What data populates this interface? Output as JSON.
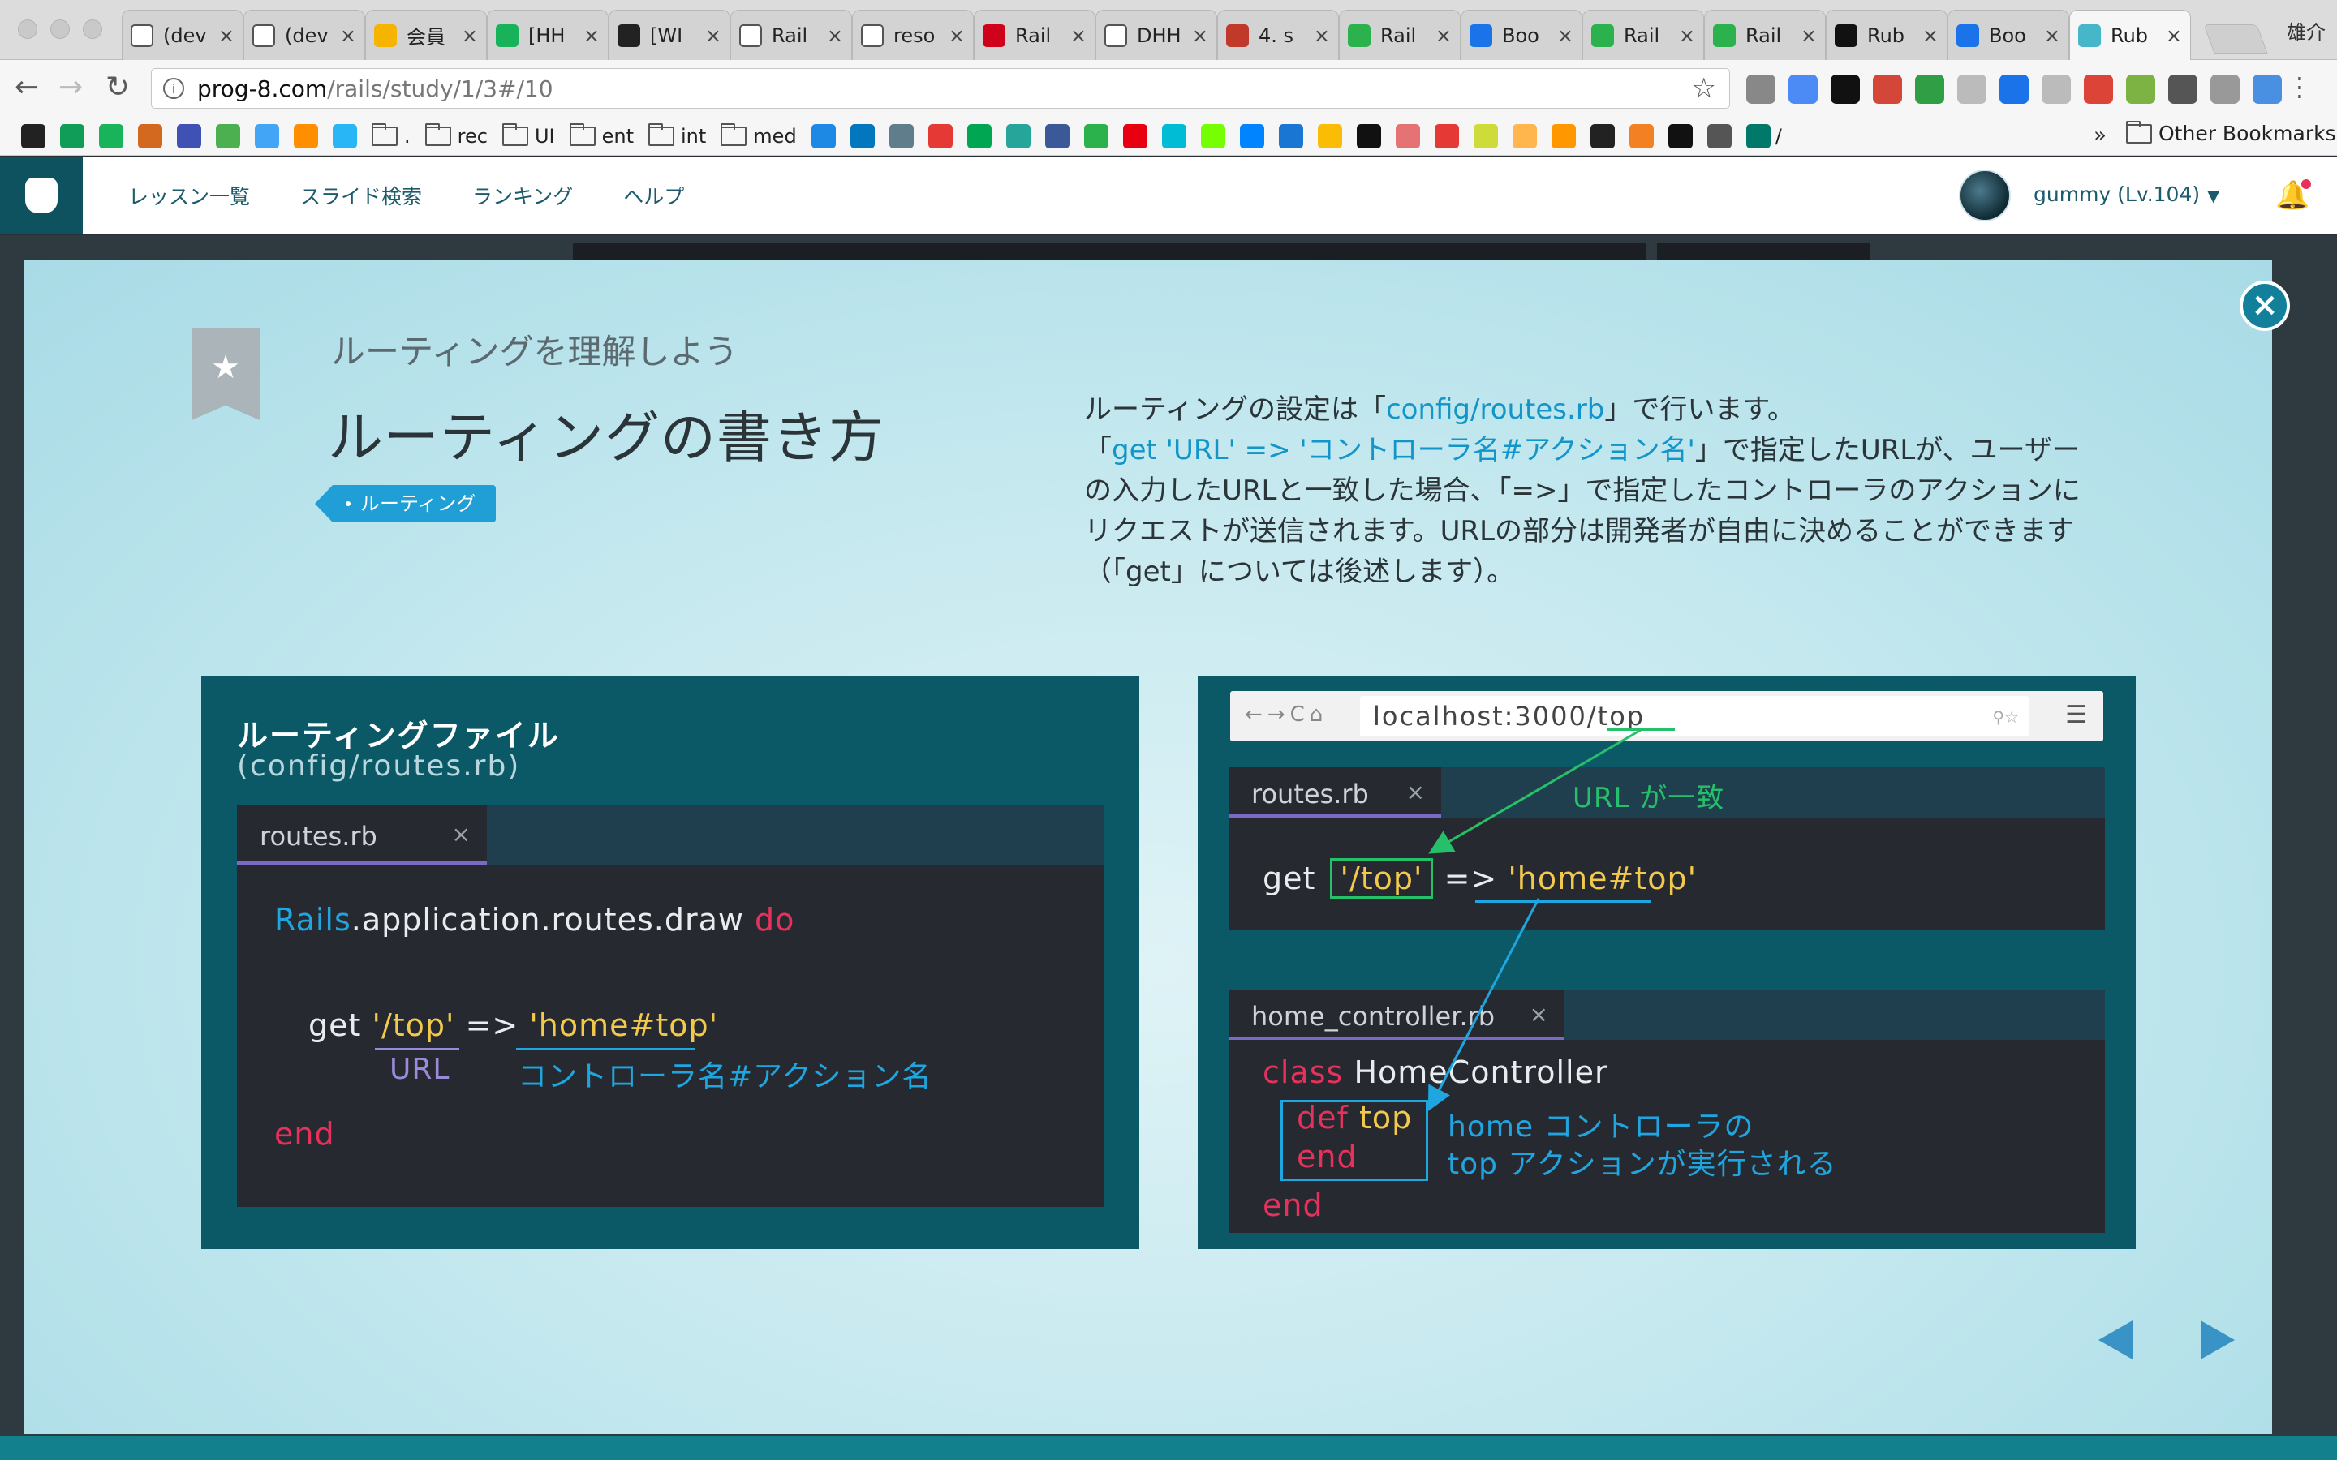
{
  "browser": {
    "tabs": [
      {
        "title": "(dev",
        "color": "#ffffff",
        "icon": "page-icon"
      },
      {
        "title": "(dev",
        "color": "#ffffff",
        "icon": "page-icon"
      },
      {
        "title": "会員",
        "color": "#f4b400",
        "icon": "slides-icon"
      },
      {
        "title": "[HH",
        "color": "#17b25a",
        "icon": "b-icon"
      },
      {
        "title": "[WI",
        "color": "#222222",
        "icon": "github-icon"
      },
      {
        "title": "Rail",
        "color": "#ffffff",
        "icon": "page-icon"
      },
      {
        "title": "reso",
        "color": "#ffffff",
        "icon": "page-icon"
      },
      {
        "title": "Rail",
        "color": "#d0021b",
        "icon": "railscasts-icon"
      },
      {
        "title": "DHH",
        "color": "#ffffff",
        "icon": "id-icon"
      },
      {
        "title": "4. s",
        "color": "#c0392b",
        "icon": "music-icon"
      },
      {
        "title": "Rail",
        "color": "#2bb24c",
        "icon": "qiita-icon"
      },
      {
        "title": "Boo",
        "color": "#1a73e8",
        "icon": "chrome-icon"
      },
      {
        "title": "Rail",
        "color": "#2bb24c",
        "icon": "qiita-icon"
      },
      {
        "title": "Rail",
        "color": "#2bb24c",
        "icon": "qiita-icon"
      },
      {
        "title": "Rub",
        "color": "#111111",
        "icon": "a-icon"
      },
      {
        "title": "Boo",
        "color": "#1a73e8",
        "icon": "chrome-icon"
      },
      {
        "title": "Rub",
        "color": "#45b7c9",
        "icon": "progate-icon",
        "active": true
      }
    ],
    "profile_name": "雄介",
    "url_host": "prog-8.com",
    "url_path": "/rails/study/1/3#/10",
    "extension_colors": [
      "#888888",
      "#4c8bf5",
      "#111111",
      "#d44638",
      "#2f9e44",
      "#bbbbbb",
      "#1a73e8",
      "#bbbbbb",
      "#db4437",
      "#7cb342",
      "#555555",
      "#999999",
      "#4a90e2"
    ],
    "bookmarks": [
      {
        "kind": "icon",
        "color": "#222222",
        "label": ""
      },
      {
        "kind": "icon",
        "color": "#0f9d58",
        "label": ""
      },
      {
        "kind": "icon",
        "color": "#19b35a",
        "label": ""
      },
      {
        "kind": "icon",
        "color": "#d2691e",
        "label": ""
      },
      {
        "kind": "icon",
        "color": "#3f51b5",
        "label": ""
      },
      {
        "kind": "icon",
        "color": "#4caf50",
        "label": ""
      },
      {
        "kind": "icon",
        "color": "#42a5f5",
        "label": ""
      },
      {
        "kind": "icon",
        "color": "#ff8f00",
        "label": ""
      },
      {
        "kind": "icon",
        "color": "#29b6f6",
        "label": ""
      },
      {
        "kind": "folder",
        "label": "."
      },
      {
        "kind": "folder",
        "label": "rec"
      },
      {
        "kind": "folder",
        "label": "UI"
      },
      {
        "kind": "folder",
        "label": "ent"
      },
      {
        "kind": "folder",
        "label": "int"
      },
      {
        "kind": "folder",
        "label": "med"
      },
      {
        "kind": "icon",
        "color": "#1e88e5",
        "label": ""
      },
      {
        "kind": "icon",
        "color": "#0277bd",
        "label": ""
      },
      {
        "kind": "icon",
        "color": "#607d8b",
        "label": ""
      },
      {
        "kind": "icon",
        "color": "#e53935",
        "label": ""
      },
      {
        "kind": "icon",
        "color": "#00a651",
        "label": ""
      },
      {
        "kind": "icon",
        "color": "#26a69a",
        "label": ""
      },
      {
        "kind": "icon",
        "color": "#3b5998",
        "label": ""
      },
      {
        "kind": "icon",
        "color": "#2bb24c",
        "label": ""
      },
      {
        "kind": "icon",
        "color": "#e60012",
        "label": ""
      },
      {
        "kind": "icon",
        "color": "#00bcd4",
        "label": ""
      },
      {
        "kind": "icon",
        "color": "#76ff03",
        "label": ""
      },
      {
        "kind": "icon",
        "color": "#0084ff",
        "label": ""
      },
      {
        "kind": "icon",
        "color": "#1976d2",
        "label": ""
      },
      {
        "kind": "icon",
        "color": "#fbbc05",
        "label": ""
      },
      {
        "kind": "icon",
        "color": "#111111",
        "label": ""
      },
      {
        "kind": "icon",
        "color": "#e57373",
        "label": ""
      },
      {
        "kind": "icon",
        "color": "#e53935",
        "label": ""
      },
      {
        "kind": "icon",
        "color": "#cddc39",
        "label": ""
      },
      {
        "kind": "icon",
        "color": "#ffb74d",
        "label": ""
      },
      {
        "kind": "icon",
        "color": "#ff9800",
        "label": ""
      },
      {
        "kind": "icon",
        "color": "#222222",
        "label": ""
      },
      {
        "kind": "icon",
        "color": "#f48024",
        "label": ""
      },
      {
        "kind": "icon",
        "color": "#111111",
        "label": ""
      },
      {
        "kind": "icon",
        "color": "#555555",
        "label": ""
      },
      {
        "kind": "icon",
        "color": "#00796b",
        "label": "/"
      }
    ],
    "bookmarks_overflow": "»",
    "other_bookmarks": "Other Bookmarks"
  },
  "site": {
    "nav": [
      "レッスン一覧",
      "スライド検索",
      "ランキング",
      "ヘルプ"
    ],
    "user_name": "gummy (Lv.104)"
  },
  "slide": {
    "subtitle": "ルーティングを理解しよう",
    "title": "ルーティングの書き方",
    "tag": "ルーティング",
    "desc": {
      "p1_a": "ルーティングの設定は「",
      "p1_file": "config/routes.rb",
      "p1_b": "」で行います。",
      "p2_a": "「",
      "p2_code": "get 'URL' => 'コントローラ名#アクション名'",
      "p2_b": "」で指定したURLが、ユーザーの入力したURLと一致した場合、「=>」で指定したコントローラのアクションにリクエストが送信されます。URLの部分は開発者が自由に決めることができます（「get」については後述します）。"
    },
    "left_panel": {
      "title": "ルーティングファイル",
      "subtitle": "(config/routes.rb)",
      "tab": "routes.rb",
      "tab_close": "×",
      "line1_const": "Rails",
      "line1_rest": ".application.routes.draw",
      "line1_kw": "do",
      "line2_get": "get",
      "line2_url": "'/top'",
      "line2_arrow": "=>",
      "line2_target": "'home#top'",
      "label_url": "URL",
      "label_controller": "コントローラ名#アクション名",
      "line3_end": "end"
    },
    "right_panel": {
      "browser_nav": "←→C⌂",
      "browser_url": "localhost:3000/top",
      "browser_url_icons": "⚲☆",
      "browser_menu": "☰",
      "routes_tab": "routes.rb",
      "tab_close": "×",
      "match_label": "URL が一致",
      "route_get": "get",
      "route_url": "'/top'",
      "route_arrow": "=>",
      "route_target": "'home#top'",
      "controller_tab": "home_controller.rb",
      "class_kw": "class",
      "class_name": "HomeController",
      "def_kw": "def",
      "def_name": "top",
      "def_end": "end",
      "note_line1": "home コントローラの",
      "note_line2": "top アクションが実行される",
      "class_end": "end"
    }
  },
  "colors": {
    "brand_dark": "#0e5260",
    "panel": "#0b5967",
    "accent_blue": "#1fa6e0",
    "keyword_red": "#e5315b",
    "string_yellow": "#f2c94c",
    "match_green": "#27c06a"
  }
}
